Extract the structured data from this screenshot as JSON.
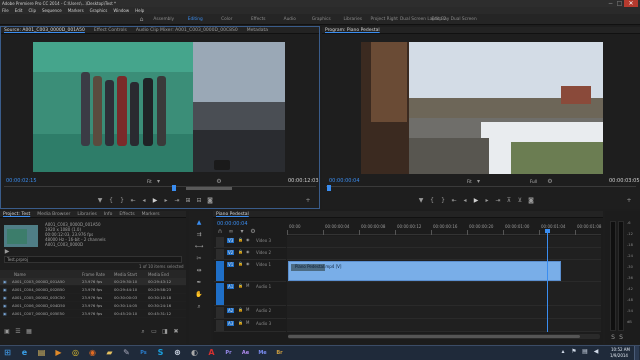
{
  "window": {
    "title": "Adobe Premiere Pro CC 2014 - C:\\Users\\…\\Desktop\\Test *"
  },
  "menu": [
    "File",
    "Edit",
    "Clip",
    "Sequence",
    "Markers",
    "Graphics",
    "Window",
    "Help"
  ],
  "workspaces": [
    {
      "label": "Assembly",
      "active": false
    },
    {
      "label": "Editing",
      "active": true
    },
    {
      "label": "Color",
      "active": false
    },
    {
      "label": "Effects",
      "active": false
    },
    {
      "label": "Audio",
      "active": false
    },
    {
      "label": "Graphics",
      "active": false
    },
    {
      "label": "Libraries",
      "active": false
    },
    {
      "label": "Project Right",
      "active": false
    },
    {
      "label": "Dual Screen Laptop 2",
      "active": false
    },
    {
      "label": "Edit Bay Dual Screen",
      "active": false
    }
  ],
  "source_monitor": {
    "tabs": [
      "Source: A001_C003_0000D_001A50",
      "Effect Controls",
      "Audio Clip Mixer: A001_C003_0000D_00C8S0",
      "Metadata"
    ],
    "timecode_in": "00:00:02:15",
    "fit": "Fit",
    "duration": "00:00:12:03"
  },
  "program_monitor": {
    "tabs": [
      "Program: Piano Pedestal"
    ],
    "timecode": "00:00:00:04",
    "fit": "Fit",
    "zoom": "Full",
    "duration": "00:00:03:05"
  },
  "project": {
    "tabs": [
      "Project: Test",
      "Media Browser",
      "Libraries",
      "Info",
      "Effects",
      "Markers"
    ],
    "file": "Test.prproj",
    "preview_meta": [
      "A001_C003_0000D_001A50",
      "1920 x 1080 (1.0)",
      "00:00:12:03, 23.976 fps",
      "48000 Hz - 16-bit - 2 channels",
      "A001_C003_0000D"
    ],
    "items_selected": "1 of 10 items selected",
    "columns": [
      "Name",
      "Frame Rate",
      "Media Start",
      "Media End"
    ],
    "rows": [
      [
        "A001_C003_0000D_001A50",
        "23.976 fps",
        "00:29:30:10",
        "00:29:43:12"
      ],
      [
        "A001_C004_0000D_002B50",
        "23.976 fps",
        "00:29:44:10",
        "00:29:58:23"
      ],
      [
        "A001_C005_0000D_003C50",
        "23.976 fps",
        "00:30:00:03",
        "00:30:10:18"
      ],
      [
        "A001_C006_0000D_004D50",
        "23.976 fps",
        "00:30:14:05",
        "00:30:24:16"
      ],
      [
        "A001_C007_0000D_005E50",
        "23.976 fps",
        "00:45:20:10",
        "00:45:31:12"
      ]
    ]
  },
  "timeline": {
    "tab": "Piano Pedestal",
    "timecode": "00:00:00:04",
    "ruler": [
      "00:00",
      "00:00:00:04",
      "00:00:00:08",
      "00:00:00:12",
      "00:00:00:16",
      "00:00:00:20",
      "00:00:01:00",
      "00:00:01:04",
      "00:00:01:08"
    ],
    "tracks": [
      "V3",
      "V2",
      "V1",
      "A1",
      "A2",
      "A3"
    ],
    "track_names": [
      "Video 3",
      "Video 2",
      "Video 1",
      "Audio 1",
      "Audio 2",
      "Audio 3"
    ],
    "clip_label": "Piano Pedestal.mp4 [V]"
  },
  "meter_labels": [
    "-6",
    "-12",
    "-18",
    "-24",
    "-30",
    "-36",
    "-42",
    "-48",
    "-54",
    "dB"
  ],
  "taskbar": {
    "time": "10:52 AM",
    "date": "1/9/2014",
    "apps": [
      "start",
      "ie",
      "explorer",
      "media",
      "chrome",
      "firefox",
      "folder",
      "notepad",
      "photoshop",
      "skype",
      "steam",
      "camera",
      "reader",
      "premiere",
      "aftereffects",
      "media-encoder",
      "bridge"
    ]
  },
  "colors": {
    "accent": "#3a8df0",
    "clip": "#79aee8",
    "track": "#1f6fc7"
  }
}
